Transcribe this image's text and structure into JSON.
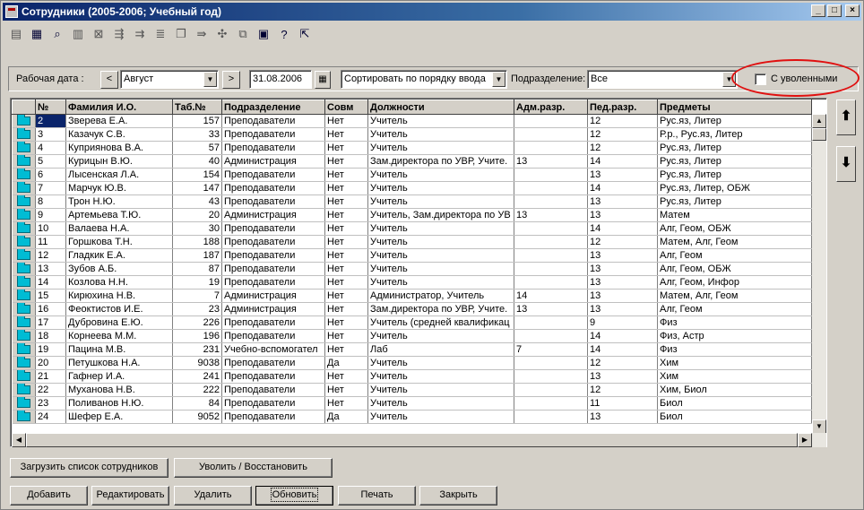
{
  "window": {
    "title": "Сотрудники (2005-2006; Учебный год)"
  },
  "filters": {
    "work_date_label": "Рабочая дата :",
    "month_value": "Август",
    "date_value": "31.08.2006",
    "sort_value": "Сортировать по порядку ввода",
    "division_label": "Подразделение:",
    "division_value": "Все",
    "fired_label": "С уволенными",
    "fired_checked": false
  },
  "table": {
    "columns": [
      "№",
      "Фамилия И.О.",
      "Таб.№",
      "Подразделение",
      "Совм",
      "Должности",
      "Адм.разр.",
      "Пед.разр.",
      "Предметы"
    ],
    "rows": [
      [
        "2",
        "Зверева Е.А.",
        "157",
        "Преподаватели",
        "Нет",
        "Учитель",
        "",
        "12",
        "Рус.яз, Литер"
      ],
      [
        "3",
        "Казачук С.В.",
        "33",
        "Преподаватели",
        "Нет",
        "Учитель",
        "",
        "12",
        "Р.р., Рус.яз, Литер"
      ],
      [
        "4",
        "Куприянова В.А.",
        "57",
        "Преподаватели",
        "Нет",
        "Учитель",
        "",
        "12",
        "Рус.яз, Литер"
      ],
      [
        "5",
        "Курицын В.Ю.",
        "40",
        "Администрация",
        "Нет",
        "Зам.директора по УВР, Учите.",
        "13",
        "14",
        "Рус.яз, Литер"
      ],
      [
        "6",
        "Лысенская Л.А.",
        "154",
        "Преподаватели",
        "Нет",
        "Учитель",
        "",
        "13",
        "Рус.яз, Литер"
      ],
      [
        "7",
        "Марчук Ю.В.",
        "147",
        "Преподаватели",
        "Нет",
        "Учитель",
        "",
        "14",
        "Рус.яз, Литер, ОБЖ"
      ],
      [
        "8",
        "Трон Н.Ю.",
        "43",
        "Преподаватели",
        "Нет",
        "Учитель",
        "",
        "13",
        "Рус.яз, Литер"
      ],
      [
        "9",
        "Артемьева Т.Ю.",
        "20",
        "Администрация",
        "Нет",
        "Учитель, Зам.директора по УВ",
        "13",
        "13",
        "Матем"
      ],
      [
        "10",
        "Валаева Н.А.",
        "30",
        "Преподаватели",
        "Нет",
        "Учитель",
        "",
        "14",
        "Алг, Геом, ОБЖ"
      ],
      [
        "11",
        "Горшкова Т.Н.",
        "188",
        "Преподаватели",
        "Нет",
        "Учитель",
        "",
        "12",
        "Матем, Алг, Геом"
      ],
      [
        "12",
        "Гладкик Е.А.",
        "187",
        "Преподаватели",
        "Нет",
        "Учитель",
        "",
        "13",
        "Алг, Геом"
      ],
      [
        "13",
        "Зубов А.Б.",
        "87",
        "Преподаватели",
        "Нет",
        "Учитель",
        "",
        "13",
        "Алг, Геом, ОБЖ"
      ],
      [
        "14",
        "Козлова Н.Н.",
        "19",
        "Преподаватели",
        "Нет",
        "Учитель",
        "",
        "13",
        "Алг, Геом, Инфор"
      ],
      [
        "15",
        "Кирюхина Н.В.",
        "7",
        "Администрация",
        "Нет",
        "Администратор, Учитель",
        "14",
        "13",
        "Матем, Алг, Геом"
      ],
      [
        "16",
        "Феоктистов И.Е.",
        "23",
        "Администрация",
        "Нет",
        "Зам.директора по УВР, Учите.",
        "13",
        "13",
        "Алг, Геом"
      ],
      [
        "17",
        "Дубровина Е.Ю.",
        "226",
        "Преподаватели",
        "Нет",
        "Учитель (средней квалификац",
        "",
        "9",
        "Физ"
      ],
      [
        "18",
        "Корнеева М.М.",
        "196",
        "Преподаватели",
        "Нет",
        "Учитель",
        "",
        "14",
        "Физ, Астр"
      ],
      [
        "19",
        "Пацина М.В.",
        "231",
        "Учебно-вспомогател",
        "Нет",
        "Лаб",
        "7",
        "14",
        "Физ"
      ],
      [
        "20",
        "Петушкова Н.А.",
        "9038",
        "Преподаватели",
        "Да",
        "Учитель",
        "",
        "12",
        "Хим"
      ],
      [
        "21",
        "Гафнер И.А.",
        "241",
        "Преподаватели",
        "Нет",
        "Учитель",
        "",
        "13",
        "Хим"
      ],
      [
        "22",
        "Муханова Н.В.",
        "222",
        "Преподаватели",
        "Нет",
        "Учитель",
        "",
        "12",
        "Хим, Биол"
      ],
      [
        "23",
        "Поливанов Н.Ю.",
        "84",
        "Преподаватели",
        "Нет",
        "Учитель",
        "",
        "11",
        "Биол"
      ],
      [
        "24",
        "Шефер Е.А.",
        "9052",
        "Преподаватели",
        "Да",
        "Учитель",
        "",
        "13",
        "Биол"
      ]
    ]
  },
  "buttons": {
    "load_list": "Загрузить список сотрудников",
    "fire_restore": "Уволить / Восстановить",
    "add": "Добавить",
    "edit": "Редактировать",
    "delete": "Удалить",
    "refresh": "Обновить",
    "print": "Печать",
    "close": "Закрыть"
  },
  "colors": {
    "title_bar": "#0a246a",
    "selection": "#0a246a",
    "highlight_oval": "#e01010",
    "row_icon": "#00bcd4"
  }
}
